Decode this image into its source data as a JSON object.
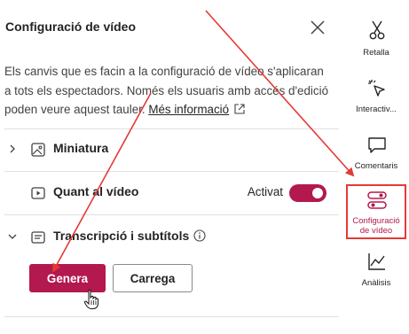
{
  "panel": {
    "title": "Configuració de vídeo",
    "description": "Els canvis que es facin a la configuració de vídeo s'aplicaran a tots els espectadors. Només els usuaris amb accés d'edició poden veure aquest tauler.",
    "more_info_link": "Més informació"
  },
  "sections": {
    "thumbnail": {
      "label": "Miniatura",
      "icon": "image-icon"
    },
    "about": {
      "label": "Quant al vídeo",
      "toggle_label": "Activat",
      "toggle_on": true,
      "icon": "play-box-icon"
    },
    "transcript": {
      "label": "Transcripció i subtítols",
      "icon": "transcript-icon"
    }
  },
  "buttons": {
    "generate": "Genera",
    "upload": "Carrega"
  },
  "rail": {
    "items": [
      {
        "label": "Retalla",
        "icon": "scissors-icon"
      },
      {
        "label": "Interactiv...",
        "icon": "interactive-cursor-icon"
      },
      {
        "label": "Comentaris",
        "icon": "comment-icon"
      },
      {
        "label": "Configuració de vídeo",
        "icon": "video-settings-icon",
        "active": true
      },
      {
        "label": "Anàlisis",
        "icon": "analytics-icon"
      }
    ]
  },
  "colors": {
    "accent": "#b3184f",
    "annotation": "#e53935"
  }
}
